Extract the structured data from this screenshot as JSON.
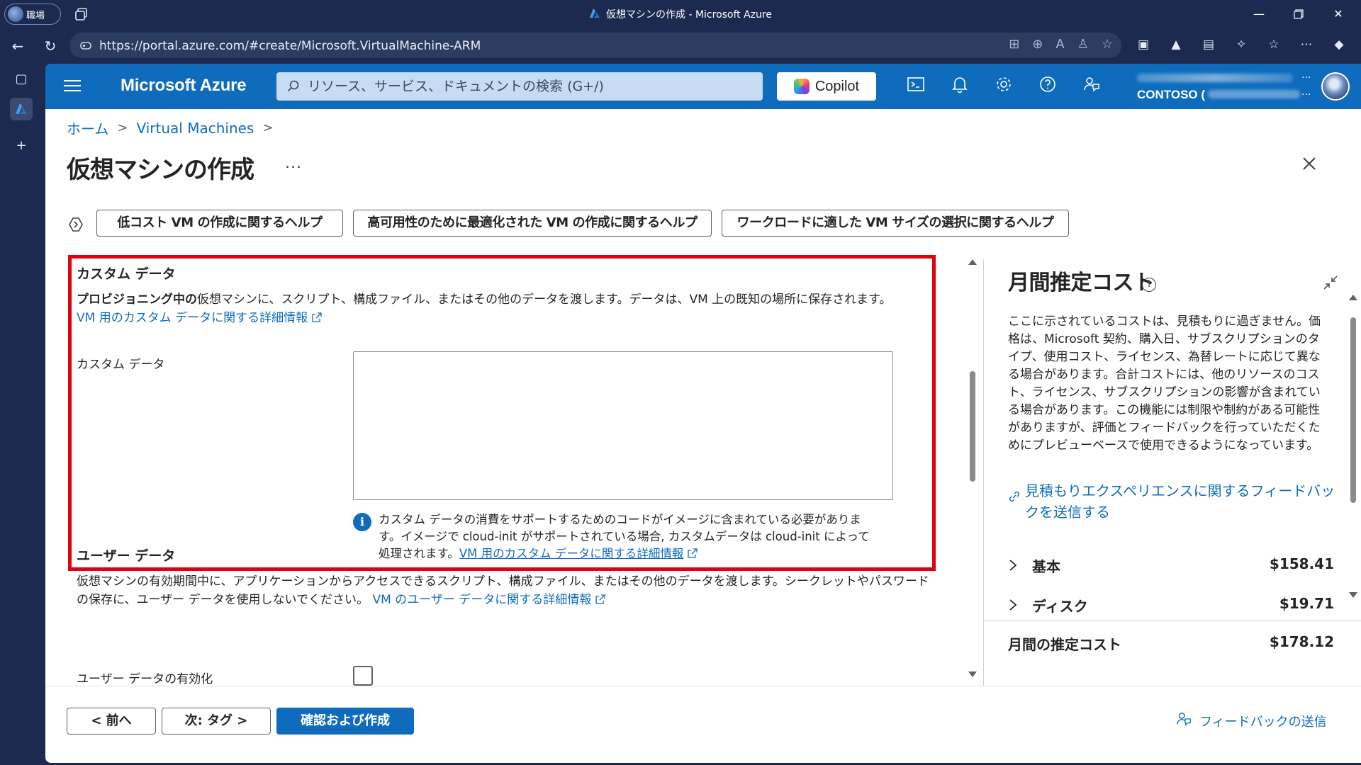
{
  "browser": {
    "profile_label": "職場",
    "window_title": "仮想マシンの作成 - Microsoft Azure",
    "url": "https://portal.azure.com/#create/Microsoft.VirtualMachine-ARM"
  },
  "portal": {
    "brand": "Microsoft Azure",
    "search_placeholder": "リソース、サービス、ドキュメントの検索 (G+/)",
    "copilot_label": "Copilot",
    "account_tenant": "CONTOSO (",
    "account_dots": "..."
  },
  "breadcrumb": {
    "home": "ホーム",
    "sep": ">",
    "vms": "Virtual Machines"
  },
  "page": {
    "title": "仮想マシンの作成",
    "more": "..."
  },
  "help_buttons": [
    "低コスト VM の作成に関するヘルプ",
    "高可用性のために最適化された VM の作成に関するヘルプ",
    "ワークロードに適した VM サイズの選択に関するヘルプ"
  ],
  "custom_data": {
    "heading": "カスタム データ",
    "desc_bold": "プロビジョニング中の",
    "desc_rest": "仮想マシンに、スクリプト、構成ファイル、またはその他のデータを渡します。データは、VM 上の既知の場所に保存されます。",
    "link": "VM 用のカスタム データに関する詳細情報",
    "field_label": "カスタム データ",
    "field_value": "",
    "info_text": "カスタム データの消費をサポートするためのコードがイメージに含まれている必要があります。イメージで cloud-init がサポートされている場合, カスタムデータは cloud-init によって処理されます。",
    "info_link": "VM 用のカスタム データに関する詳細情報"
  },
  "user_data": {
    "heading": "ユーザー データ",
    "desc": "仮想マシンの有効期間中に、アプリケーションからアクセスできるスクリプト、構成ファイル、またはその他のデータを渡します。シークレットやパスワードの保存に、ユーザー データを使用しないでください。",
    "link": "VM のユーザー データに関する詳細情報",
    "enable_label": "ユーザー データの有効化",
    "enabled": false
  },
  "cost": {
    "title": "月間推定コスト",
    "info_glyph": "i",
    "desc": "ここに示されているコストは、見積もりに過ぎません。価格は、Microsoft 契約、購入日、サブスクリプションのタイプ、使用コスト、ライセンス、為替レートに応じて異なる場合があります。合計コストには、他のリソースのコスト、ライセンス、サブスクリプションの影響が含まれている場合があります。この機能には制限や制約がある可能性がありますが、評価とフィードバックを行っていただくためにプレビューベースで使用できるようになっています。",
    "feedback_link": "見積もりエクスペリエンスに関するフィードバックを送信する",
    "rows": [
      {
        "label": "基本",
        "amount": "$158.41"
      },
      {
        "label": "ディスク",
        "amount": "$19.71"
      }
    ],
    "total_label": "月間の推定コスト",
    "total_amount": "$178.12"
  },
  "footer": {
    "prev": "< 前へ",
    "next": "次: タグ >",
    "review": "確認および作成",
    "feedback": "フィードバックの送信"
  },
  "colors": {
    "azure_blue": "#0f6cbd",
    "highlight_red": "#e0000f",
    "chrome_bg": "#1b2a4e"
  }
}
